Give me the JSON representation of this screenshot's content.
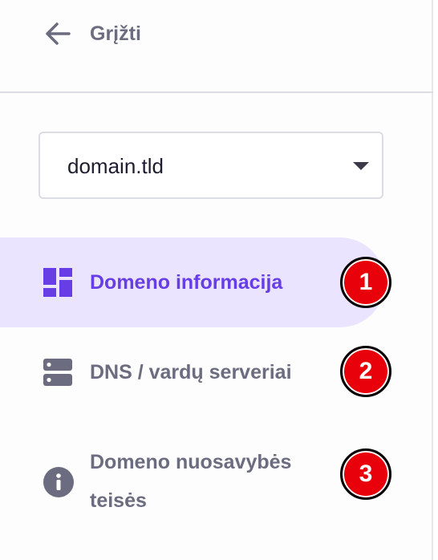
{
  "back": {
    "label": "Grįžti",
    "icon": "arrow-left-icon"
  },
  "domain_select": {
    "value": "domain.tld"
  },
  "nav": {
    "items": [
      {
        "label": "Domeno informacija",
        "icon": "dashboard-grid-icon",
        "active": true,
        "badge": "1"
      },
      {
        "label": "DNS / vardų serveriai",
        "icon": "server-icon",
        "active": false,
        "badge": "2"
      },
      {
        "label_line1": "Domeno nuosavybės",
        "label_line2": "teisės",
        "icon": "info-icon",
        "active": false,
        "badge": "3"
      }
    ]
  },
  "colors": {
    "accent": "#673de6",
    "active_bg": "#ebe4ff",
    "muted_text": "#6c6c80",
    "badge_red": "#e8000a"
  }
}
